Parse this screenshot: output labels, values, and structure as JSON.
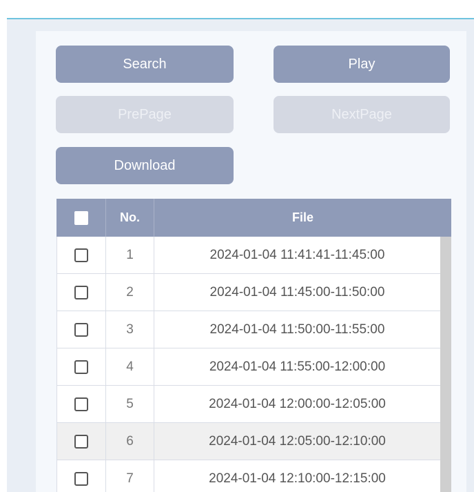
{
  "buttons": {
    "search": "Search",
    "play": "Play",
    "prepage": "PrePage",
    "nextpage": "NextPage",
    "download": "Download"
  },
  "table": {
    "headers": {
      "number": "No.",
      "file": "File"
    },
    "rows": [
      {
        "no": "1",
        "file": "2024-01-04 11:41:41-11:45:00"
      },
      {
        "no": "2",
        "file": "2024-01-04 11:45:00-11:50:00"
      },
      {
        "no": "3",
        "file": "2024-01-04 11:50:00-11:55:00"
      },
      {
        "no": "4",
        "file": "2024-01-04 11:55:00-12:00:00"
      },
      {
        "no": "5",
        "file": "2024-01-04 12:00:00-12:05:00"
      },
      {
        "no": "6",
        "file": "2024-01-04 12:05:00-12:10:00"
      },
      {
        "no": "7",
        "file": "2024-01-04 12:10:00-12:15:00"
      }
    ]
  },
  "colors": {
    "accent_line": "#6fc3df",
    "button": "#8f9bb8",
    "button_disabled": "#d4d8e2",
    "header_bg": "#8f9bb8"
  }
}
